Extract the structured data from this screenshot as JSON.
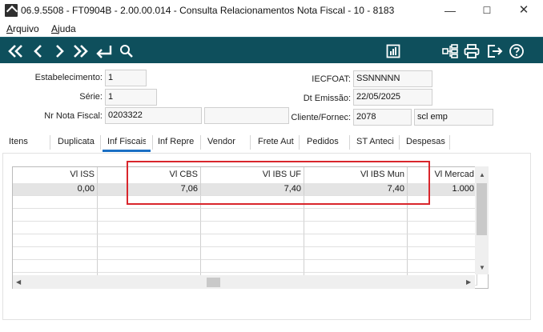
{
  "window": {
    "title": "06.9.5508 - FT0904B - 2.00.00.014 - Consulta Relacionamentos Nota Fiscal - 10 - 8183",
    "minimize": "—",
    "maximize": "☐",
    "close": "✕"
  },
  "menu": {
    "items": [
      {
        "first": "A",
        "rest": "rquivo"
      },
      {
        "first": "A",
        "rest": "juda"
      }
    ]
  },
  "toolbar": {
    "left_icons": [
      "first-icon",
      "previous-icon",
      "next-icon",
      "last-icon",
      "go-to-icon",
      "search-icon"
    ],
    "right_icons": [
      "report-icon",
      "tree-icon",
      "print-icon",
      "exit-icon",
      "help-icon"
    ]
  },
  "header": {
    "estabelecimento": {
      "label": "Estabelecimento:",
      "value": "1"
    },
    "serie": {
      "label": "Série:",
      "value": "1"
    },
    "nr_nota": {
      "label": "Nr Nota Fiscal:",
      "value": "0203322",
      "extra": ""
    },
    "iecfoat": {
      "label": "IECFOAT:",
      "value": "SSNNNNN"
    },
    "dt_emissao": {
      "label": "Dt Emissão:",
      "value": "22/05/2025"
    },
    "cliente": {
      "label": "Cliente/Fornec:",
      "code": "2078",
      "name": "scl emp"
    }
  },
  "tabs": [
    {
      "label": "Itens"
    },
    {
      "label": "Duplicata"
    },
    {
      "label": "Inf Fiscais"
    },
    {
      "label": "Inf Repre"
    },
    {
      "label": "Vendor"
    },
    {
      "label": "Frete Aut"
    },
    {
      "label": "Pedidos"
    },
    {
      "label": "ST Anteci"
    },
    {
      "label": "Despesas"
    }
  ],
  "active_tab": 2,
  "grid": {
    "columns": [
      "Vl ISS",
      "Vl CBS",
      "Vl IBS UF",
      "Vl IBS Mun",
      "Vl Mercad"
    ],
    "rows": [
      [
        "0,00",
        "7,06",
        "7,40",
        "7,40",
        "1.000"
      ],
      [
        "",
        "",
        "",
        "",
        ""
      ],
      [
        "",
        "",
        "",
        "",
        ""
      ],
      [
        "",
        "",
        "",
        "",
        ""
      ],
      [
        "",
        "",
        "",
        "",
        ""
      ],
      [
        "",
        "",
        "",
        "",
        ""
      ],
      [
        "",
        "",
        "",
        "",
        ""
      ],
      [
        "",
        "",
        "",
        "",
        ""
      ]
    ]
  },
  "colors": {
    "toolbar": "#0e4f5c",
    "tab_active_underline": "#1a6fc4",
    "highlight_border": "#d9262c"
  }
}
